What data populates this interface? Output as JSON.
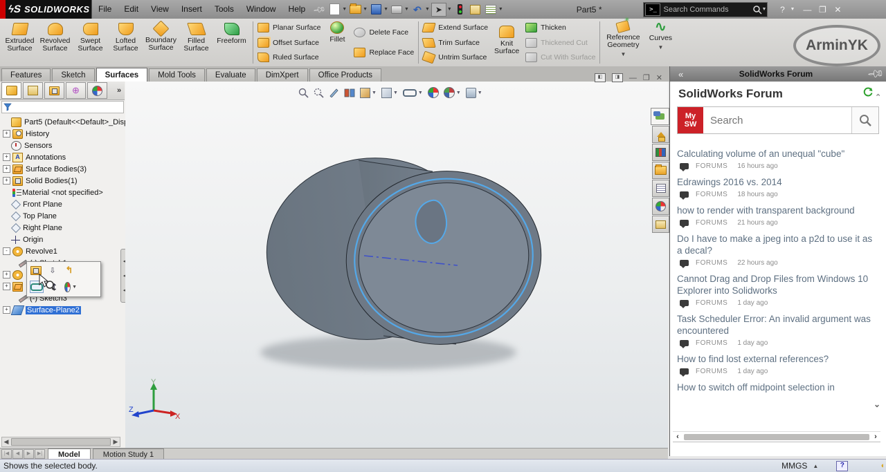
{
  "menu": {
    "logo_text": "SOLIDWORKS",
    "items": [
      "File",
      "Edit",
      "View",
      "Insert",
      "Tools",
      "Window",
      "Help"
    ],
    "document_title": "Part5 *",
    "search_placeholder": "Search Commands"
  },
  "ribbon": {
    "large_buttons": [
      {
        "line1": "Extruded",
        "line2": "Surface"
      },
      {
        "line1": "Revolved",
        "line2": "Surface"
      },
      {
        "line1": "Swept",
        "line2": "Surface"
      },
      {
        "line1": "Lofted",
        "line2": "Surface"
      },
      {
        "line1": "Boundary",
        "line2": "Surface"
      },
      {
        "line1": "Filled",
        "line2": "Surface"
      },
      {
        "line1": "Freeform",
        "line2": ""
      }
    ],
    "planar_group": [
      "Planar Surface",
      "Offset Surface",
      "Ruled Surface"
    ],
    "fillet_label": "Fillet",
    "face_group": [
      "Delete Face",
      "Replace Face"
    ],
    "extend_group": [
      "Extend Surface",
      "Trim Surface",
      "Untrim Surface"
    ],
    "knit": {
      "line1": "Knit",
      "line2": "Surface"
    },
    "thicken_group": [
      "Thicken",
      "Thickened Cut",
      "Cut With Surface"
    ],
    "ref_geometry": {
      "line1": "Reference",
      "line2": "Geometry"
    },
    "curves_label": "Curves",
    "watermark": "ArminYK"
  },
  "command_tabs": {
    "items": [
      "Features",
      "Sketch",
      "Surfaces",
      "Mold Tools",
      "Evaluate",
      "DimXpert",
      "Office Products"
    ],
    "active": "Surfaces"
  },
  "tree": {
    "items": [
      {
        "label": "Part5 (Default<<Default>_Disp",
        "icon": "part-icon",
        "expander": ""
      },
      {
        "label": "History",
        "icon": "history-folder-icon",
        "expander": "+"
      },
      {
        "label": "Sensors",
        "icon": "sensors-icon",
        "expander": ""
      },
      {
        "label": "Annotations",
        "icon": "annotations-icon",
        "expander": "+"
      },
      {
        "label": "Surface Bodies(3)",
        "icon": "surface-bodies-folder-icon",
        "expander": "+"
      },
      {
        "label": "Solid Bodies(1)",
        "icon": "solid-bodies-folder-icon",
        "expander": "+"
      },
      {
        "label": "Material <not specified>",
        "icon": "material-icon",
        "expander": ""
      },
      {
        "label": "Front Plane",
        "icon": "plane-icon",
        "expander": ""
      },
      {
        "label": "Top Plane",
        "icon": "plane-icon",
        "expander": ""
      },
      {
        "label": "Right Plane",
        "icon": "plane-icon",
        "expander": ""
      },
      {
        "label": "Origin",
        "icon": "origin-icon",
        "expander": ""
      },
      {
        "label": "Revolve1",
        "icon": "revolve-icon",
        "expander": "-"
      },
      {
        "label": "(-) Sketch1",
        "icon": "sketch-icon",
        "expander": ""
      },
      {
        "label": "",
        "icon": "feature-icon",
        "expander": "+"
      },
      {
        "label": "",
        "icon": "feature-icon",
        "expander": "+"
      },
      {
        "label": "(-) Sketch3",
        "icon": "sketch-icon",
        "expander": ""
      },
      {
        "label": "Surface-Plane2",
        "icon": "surface-plane-icon",
        "expander": "+",
        "selected": true
      }
    ]
  },
  "context_popup": {
    "icons": [
      "add-to-new-folder",
      "feature-properties",
      "undo",
      "hide-show",
      "normal-to",
      "appearance"
    ]
  },
  "viewport": {
    "triad": {
      "x_label": "X",
      "y_label": "Y",
      "z_label": "Z"
    }
  },
  "taskpane": {
    "titlebar": "SolidWorks Forum",
    "heading": "SolidWorks Forum",
    "logo_line1": "My",
    "logo_line2": "SW",
    "search_placeholder": "Search",
    "strip_icons": [
      "forum",
      "resources-home",
      "design-library",
      "file-explorer",
      "view-palette",
      "appearances",
      "custom-properties"
    ],
    "posts": [
      {
        "title": "Calculating volume of an unequal \"cube\"",
        "forum": "FORUMS",
        "time": "16 hours ago"
      },
      {
        "title": "Edrawings 2016 vs. 2014",
        "forum": "FORUMS",
        "time": "18 hours ago"
      },
      {
        "title": "how to render with transparent background",
        "forum": "FORUMS",
        "time": "21 hours ago"
      },
      {
        "title": "Do I have to make a jpeg into a p2d to use it as a decal?",
        "forum": "FORUMS",
        "time": "22 hours ago"
      },
      {
        "title": "Cannot Drag and Drop Files from Windows 10 Explorer into Solidworks",
        "forum": "FORUMS",
        "time": "1 day ago"
      },
      {
        "title": "Task Scheduler Error: An invalid argument was encountered",
        "forum": "FORUMS",
        "time": "1 day ago"
      },
      {
        "title": "How to find lost external references?",
        "forum": "FORUMS",
        "time": "1 day ago"
      },
      {
        "title": "How to switch off midpoint selection in",
        "forum": "",
        "time": ""
      }
    ]
  },
  "bottom": {
    "tabs": [
      "Model",
      "Motion Study 1"
    ],
    "active_tab": "Model",
    "status_message": "Shows the selected body.",
    "units": "MMGS"
  }
}
